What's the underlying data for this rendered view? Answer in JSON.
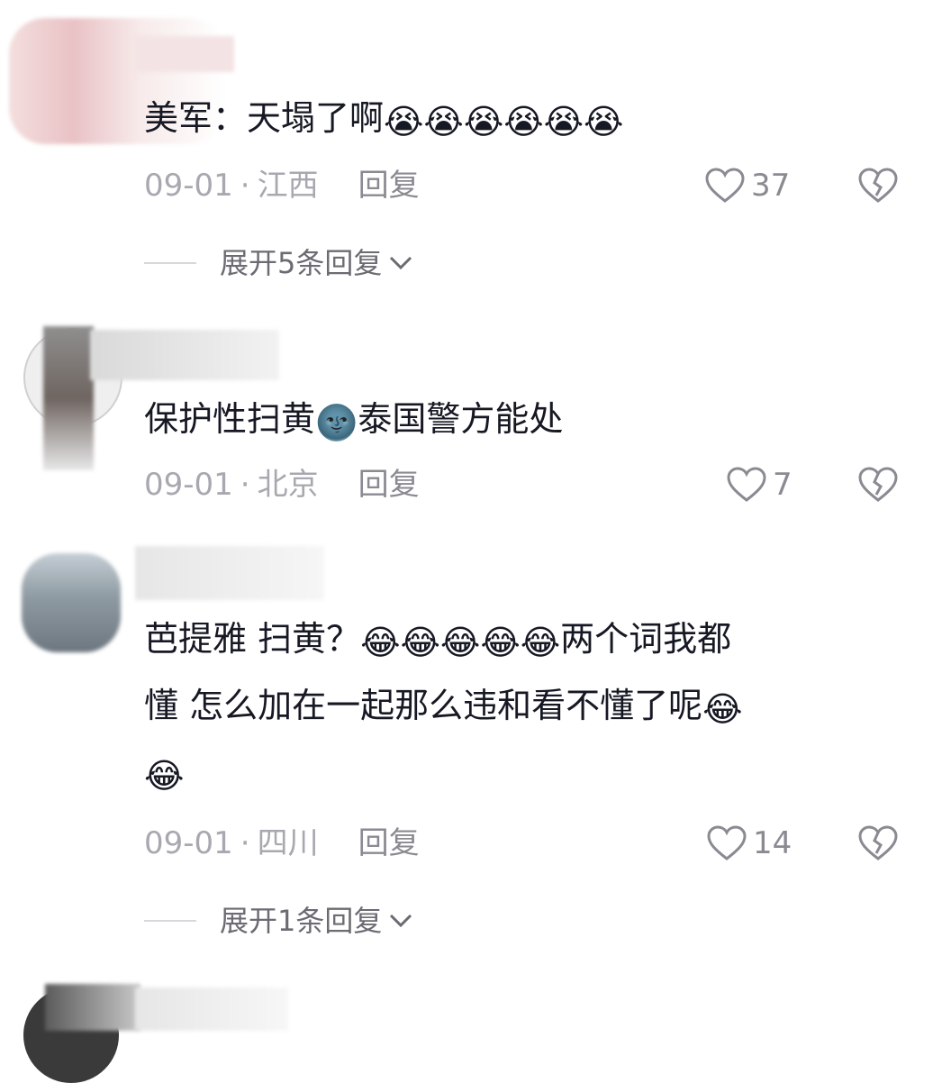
{
  "comments": [
    {
      "text": "美军：天塌了啊",
      "emojis": [
        "😭",
        "😭",
        "😭",
        "😭",
        "😭",
        "😭"
      ],
      "date": "09-01",
      "location": "江西",
      "reply_label": "回复",
      "likes": "37",
      "expand_label": "展开5条回复"
    },
    {
      "text_before": "保护性扫黄",
      "emoji_mid": "🌚",
      "text_after": "泰国警方能处",
      "date": "09-01",
      "location": "北京",
      "reply_label": "回复",
      "likes": "7"
    },
    {
      "text_line1_a": "芭提雅 扫黄？",
      "emojis_line1": [
        "😂",
        "😂",
        "😂",
        "😂",
        "😂"
      ],
      "text_line1_b": "两个词我都",
      "text_line2": "懂 怎么加在一起那么违和看不懂了呢",
      "emoji_line2": "😂",
      "emoji_line3": "😂",
      "date": "09-01",
      "location": "四川",
      "reply_label": "回复",
      "likes": "14",
      "expand_label": "展开1条回复"
    }
  ],
  "colors": {
    "text": "#161823",
    "meta": "#a8a8b0",
    "icon": "#8a8a92"
  }
}
